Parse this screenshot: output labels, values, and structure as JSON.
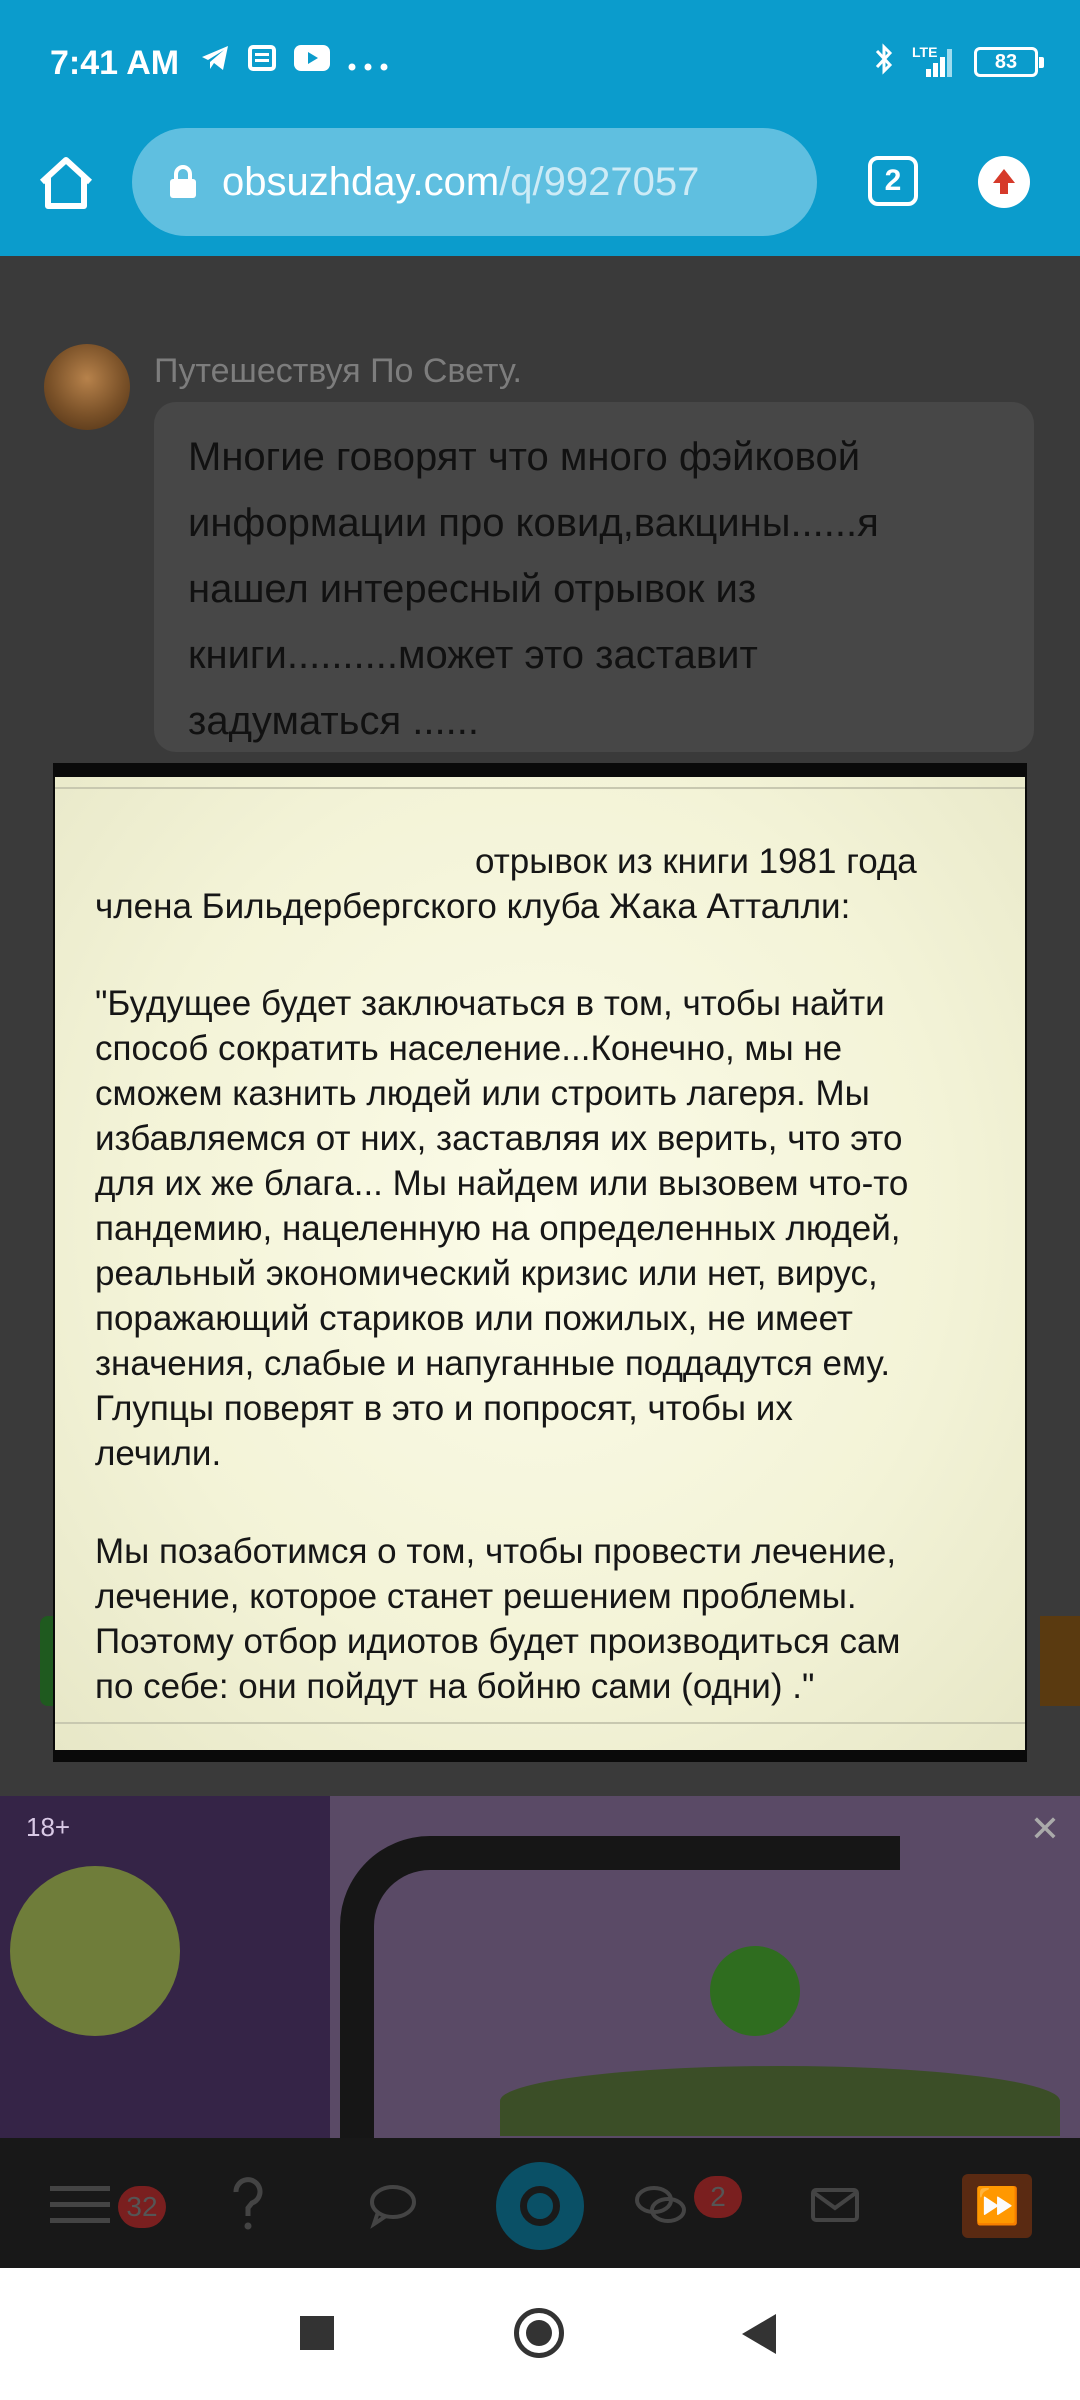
{
  "status_bar": {
    "time": "7:41 AM",
    "left_icons": [
      "telegram-icon",
      "news-icon",
      "youtube-icon",
      "more-dots-icon"
    ],
    "network_label": "LTE",
    "battery_level": "83"
  },
  "browser": {
    "url_domain": "obsuzhday.com",
    "url_path": "/q/9927057",
    "tab_count": "2"
  },
  "post": {
    "author": "Путешествуя По Свету.",
    "text_lines": [
      "Многие говорят что много фэйковой",
      "информации про ковид,вакцины......я",
      "нашел интересный отрывок из",
      "книги..........может это заставит",
      "задуматься ......"
    ]
  },
  "excerpt": {
    "header_lines": [
      "отрывок из книги 1981 года",
      "члена Бильдербергского клуба Жака Атталли:"
    ],
    "paragraph1_lines": [
      "\"Будущее будет заключаться в том, чтобы найти",
      "способ сократить население...Конечно, мы не",
      "сможем казнить людей или строить лагеря. Мы",
      "избавляемся от них, заставляя их верить, что это",
      "для их же блага... Мы найдем или вызовем что-то",
      "пандемию, нацеленную на определенных людей,",
      "реальный экономический кризис или нет, вирус,",
      "поражающий стариков или пожилых, не имеет",
      "значения, слабые и напуганные поддадутся ему.",
      "Глупцы поверят в это и попросят, чтобы их",
      "лечили."
    ],
    "paragraph2_lines": [
      "Мы позаботимся о том, чтобы провести лечение,",
      "лечение, которое станет решением проблемы.",
      "Поэтому отбор идиотов будет производиться сам",
      "по себе: они пойдут на бойню сами (одни) .\""
    ]
  },
  "ad": {
    "age_badge": "18+",
    "close_symbol": "✕"
  },
  "site_nav": {
    "menu_badge": "32",
    "messages_badge": "2",
    "ff_symbol": "⏩"
  }
}
